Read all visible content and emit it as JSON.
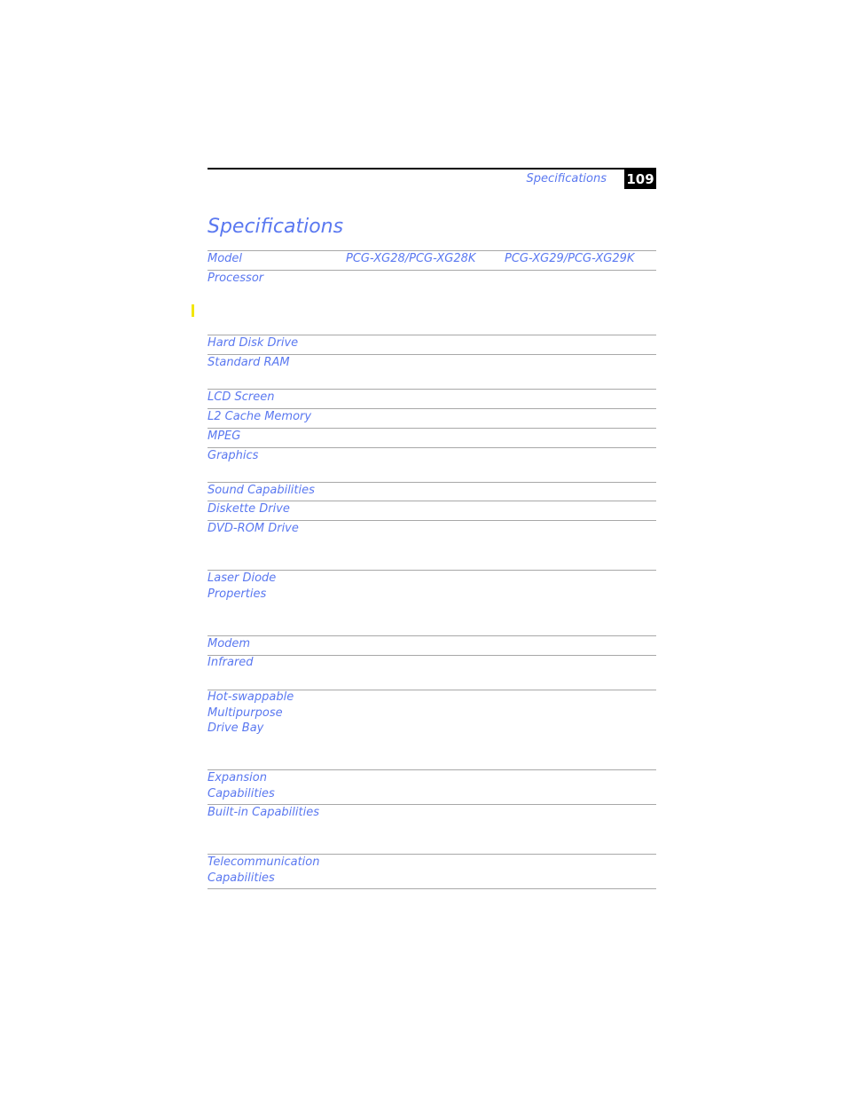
{
  "header": {
    "running_title": "Specifications",
    "page_number": "109"
  },
  "section_title": "Specifications",
  "table": {
    "columns": [
      "Model",
      "PCG-XG28/PCG-XG28K",
      "PCG-XG29/PCG-XG29K"
    ],
    "rows": [
      {
        "label": "Processor"
      },
      {
        "label": "Hard Disk Drive"
      },
      {
        "label": "Standard RAM"
      },
      {
        "label": "LCD Screen"
      },
      {
        "label": "L2 Cache Memory"
      },
      {
        "label": "MPEG"
      },
      {
        "label": "Graphics"
      },
      {
        "label": "Sound Capabilities"
      },
      {
        "label": "Diskette Drive"
      },
      {
        "label": "DVD-ROM Drive"
      },
      {
        "label": "Laser Diode\nProperties"
      },
      {
        "label": "Modem"
      },
      {
        "label": "Infrared"
      },
      {
        "label": "Hot-swappable\nMultipurpose\nDrive Bay"
      },
      {
        "label": "Expansion\nCapabilities"
      },
      {
        "label": "Built-in Capabilities"
      },
      {
        "label": "Telecommunication\nCapabilities"
      }
    ]
  },
  "colors": {
    "accent_text": "#5a78f0",
    "rule": "#a8a8a8",
    "highlight_marker": "#f2e600"
  }
}
